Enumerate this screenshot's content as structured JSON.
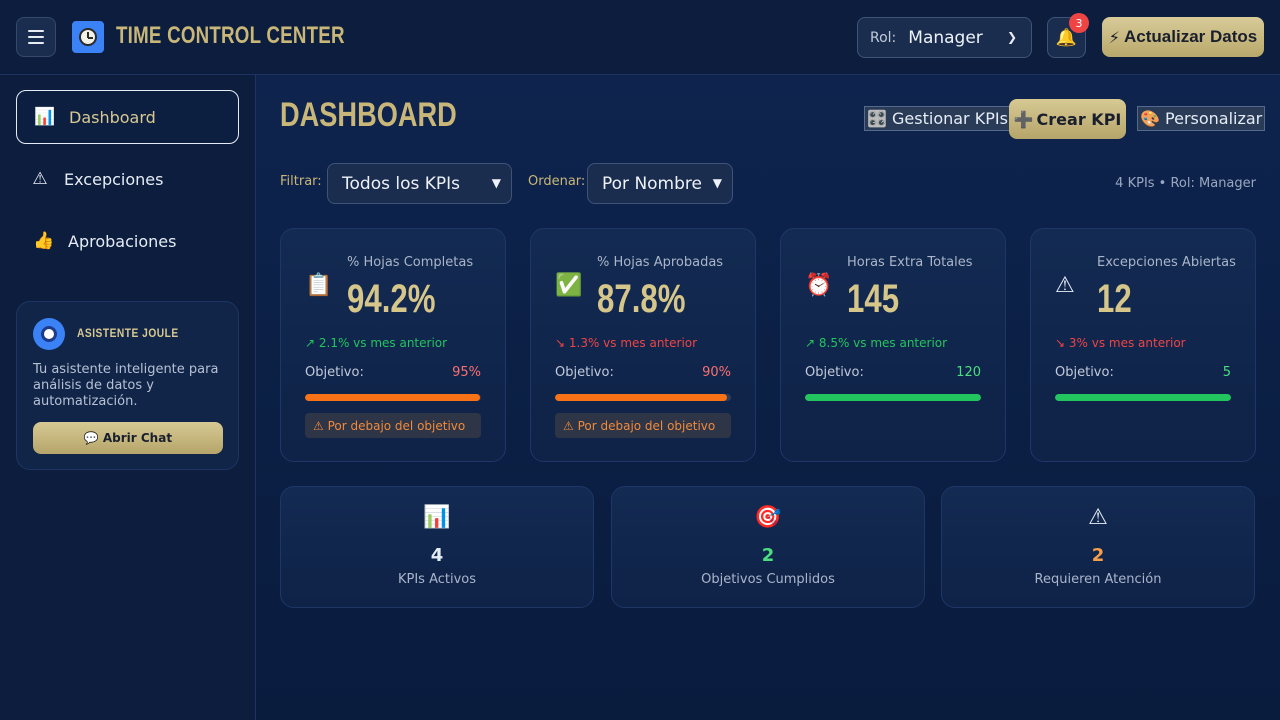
{
  "header": {
    "app_title": "TIME CONTROL CENTER",
    "role_label": "Rol:",
    "role_value": "Manager",
    "notification_count": "3",
    "refresh_icon": "⚡",
    "refresh_label": "Actualizar Datos"
  },
  "sidebar": {
    "items": [
      {
        "icon": "📊",
        "label": "Dashboard",
        "active": true
      },
      {
        "icon": "⚠",
        "label": "Excepciones",
        "active": false
      },
      {
        "icon": "👍",
        "label": "Aprobaciones",
        "active": false
      }
    ],
    "assistant": {
      "title": "ASISTENTE JOULE",
      "description": "Tu asistente inteligente para análisis de datos y automatización.",
      "button_icon": "💬",
      "button_label": "Abrir Chat"
    }
  },
  "main": {
    "title": "DASHBOARD",
    "toolbar": {
      "manage_icon": "🎛️",
      "manage_label": "Gestionar KPIs",
      "create_icon": "➕",
      "create_label": "Crear KPI",
      "customize_icon": "🎨",
      "customize_label": "Personalizar"
    },
    "filters": {
      "filter_label": "Filtrar:",
      "filter_value": "Todos los KPIs",
      "sort_label": "Ordenar:",
      "sort_value": "Por Nombre",
      "meta": "4 KPIs • Rol: Manager"
    },
    "kpis": [
      {
        "icon": "📋",
        "name": "% Hojas Completas",
        "value": "94.2%",
        "trend": "↗ 2.1% vs mes anterior",
        "trend_color": "#22c55e",
        "objective_label": "Objetivo:",
        "target": "95%",
        "target_color": "#f87171",
        "progress": 0.992,
        "bar_color": "#f97316",
        "warning": "⚠  Por debajo del objetivo"
      },
      {
        "icon": "✅",
        "name": "% Hojas Aprobadas",
        "value": "87.8%",
        "trend": "↘ 1.3% vs mes anterior",
        "trend_color": "#ef4444",
        "objective_label": "Objetivo:",
        "target": "90%",
        "target_color": "#f87171",
        "progress": 0.976,
        "bar_color": "#f97316",
        "warning": "⚠  Por debajo del objetivo"
      },
      {
        "icon": "⏰",
        "name": "Horas Extra Totales",
        "value": "145",
        "trend": "↗ 8.5% vs mes anterior",
        "trend_color": "#22c55e",
        "objective_label": "Objetivo:",
        "target": "120",
        "target_color": "#4ade80",
        "progress": 1.0,
        "bar_color": "#22c55e",
        "warning": ""
      },
      {
        "icon": "⚠",
        "name": "Excepciones Abiertas",
        "value": "12",
        "trend": "↘ 3% vs mes anterior",
        "trend_color": "#ef4444",
        "objective_label": "Objetivo:",
        "target": "5",
        "target_color": "#4ade80",
        "progress": 1.0,
        "bar_color": "#22c55e",
        "warning": ""
      }
    ],
    "summary": [
      {
        "icon": "📊",
        "value": "4",
        "value_color": "#e6ecf5",
        "label": "KPIs Activos"
      },
      {
        "icon": "🎯",
        "value": "2",
        "value_color": "#4ade80",
        "label": "Objetivos Cumplidos"
      },
      {
        "icon": "⚠",
        "value": "2",
        "value_color": "#f59e4b",
        "label": "Requieren Atención"
      }
    ]
  }
}
